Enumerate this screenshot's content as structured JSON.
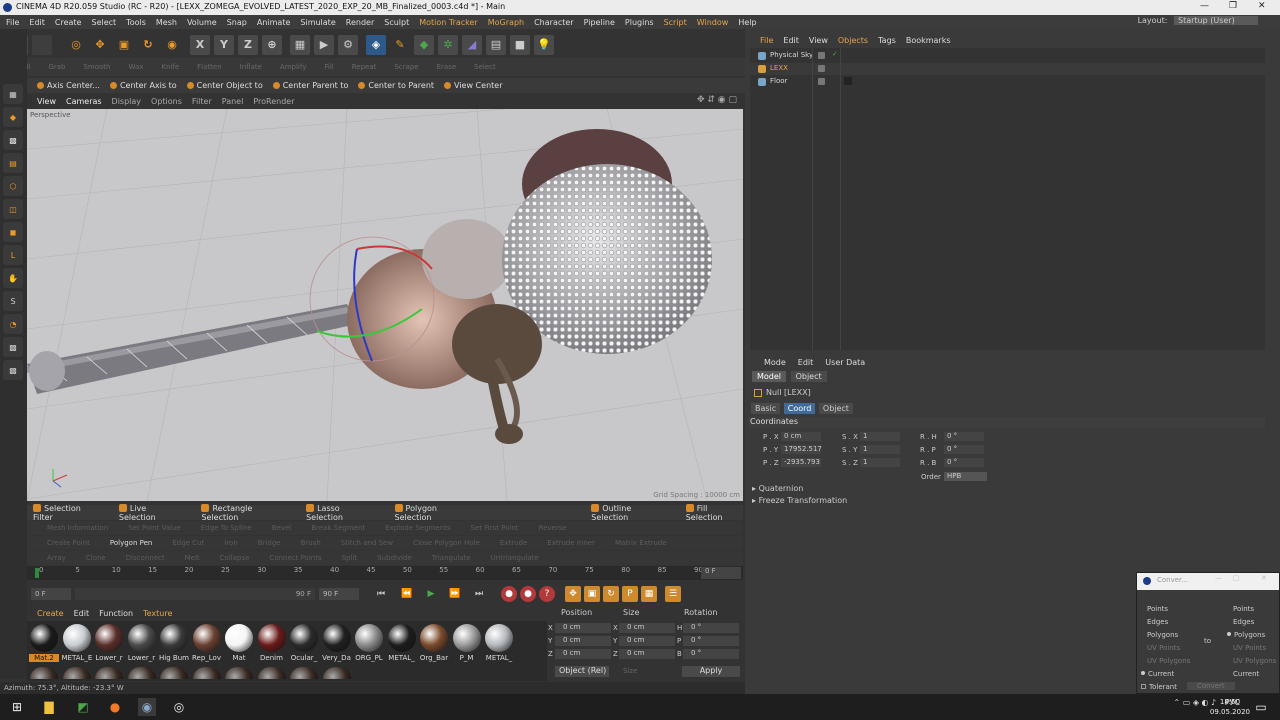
{
  "title_bar": {
    "title": "CINEMA 4D R20.059 Studio (RC - R20) - [LEXX_ZOMEGA_EVOLVED_LATEST_2020_EXP_20_MB_Finalized_0003.c4d *] - Main",
    "minimize": "—",
    "maximize": "❐",
    "close": "✕"
  },
  "menu": {
    "items": [
      "File",
      "Edit",
      "Create",
      "Select",
      "Tools",
      "Mesh",
      "Volume",
      "Snap",
      "Animate",
      "Simulate",
      "Render",
      "Sculpt",
      "Motion Tracker",
      "MoGraph",
      "Character",
      "Pipeline",
      "Plugins",
      "Script",
      "Window",
      "Help"
    ],
    "layout_label": "Layout:",
    "layout_value": "Startup (User)"
  },
  "top_toolbar": {
    "undo": "↶",
    "axis_x": "X",
    "axis_y": "Y",
    "axis_z": "Z"
  },
  "dim_tools": [
    "Pull",
    "Grab",
    "Smooth",
    "Wax",
    "Knife",
    "Flatten",
    "Inflate",
    "Amplify",
    "Fill",
    "Repeat",
    "Scrape",
    "Erase",
    "Select"
  ],
  "axis_bar": [
    "Axis Center...",
    "Center Axis to",
    "Center Object to",
    "Center Parent to",
    "Center to Parent",
    "View Center"
  ],
  "viewport": {
    "menu": [
      "View",
      "Cameras",
      "Display",
      "Options",
      "Filter",
      "Panel",
      "ProRender"
    ],
    "label": "Perspective",
    "grid_spacing": "Grid Spacing : 10000 cm"
  },
  "selection_bar": [
    "Selection Filter",
    "Live Selection",
    "Rectangle Selection",
    "Lasso Selection",
    "Polygon Selection",
    "Outline Selection",
    "Fill Selection"
  ],
  "dim_rows": [
    [
      "Mesh Information",
      "Set Point Value",
      "Edge To Spline",
      "Bevel",
      "Break Segment",
      "Explode Segments",
      "Set First Point",
      "Reverse"
    ],
    [
      "Create Point",
      "Polygon Pen",
      "Edge Cut",
      "Iron",
      "Bridge",
      "Brush",
      "Stitch and Sew",
      "Close Polygon Hole",
      "Extrude",
      "Extrude Inner",
      "Matrix Extrude"
    ],
    [
      "Array",
      "Clone",
      "Disconnect",
      "Melt",
      "Collapse",
      "Connect Points",
      "Split",
      "Subdivide",
      "Triangulate",
      "Untriangulate"
    ]
  ],
  "timeline": {
    "ticks": [
      "0",
      "5",
      "10",
      "15",
      "20",
      "25",
      "30",
      "35",
      "40",
      "45",
      "50",
      "55",
      "60",
      "65",
      "70",
      "75",
      "80",
      "85",
      "90"
    ],
    "end_frame": "0 F",
    "start_field": "0 F",
    "mid_field": "90 F",
    "end_field": "90 F"
  },
  "playback": {
    "first": "⏮",
    "prev": "⏪",
    "play": "▶",
    "next": "⏩",
    "last": "⏭"
  },
  "material_manager": {
    "menu": [
      "Create",
      "Edit",
      "Function",
      "Texture"
    ],
    "materials": [
      {
        "name": "Mat.2",
        "color": "#1a1a1a",
        "selected": true
      },
      {
        "name": "METAL_E",
        "color": "#c8ccd0"
      },
      {
        "name": "Lower_r",
        "color": "#5a2e2a"
      },
      {
        "name": "Lower_r",
        "color": "#4a4a4a"
      },
      {
        "name": "Hig Bum",
        "color": "#3a3a3a"
      },
      {
        "name": "Rep_Lov",
        "color": "#6a4030"
      },
      {
        "name": "Mat",
        "color": "#f4f4f4"
      },
      {
        "name": "Denim",
        "color": "#6a1a1a"
      },
      {
        "name": "Ocular_",
        "color": "#2a2a2a"
      },
      {
        "name": "Very_Da",
        "color": "#202020"
      },
      {
        "name": "ORG_PL",
        "color": "#8a8a8a"
      },
      {
        "name": "METAL_",
        "color": "#1c1c1c"
      },
      {
        "name": "Org_Bar",
        "color": "#7a4a2a"
      },
      {
        "name": "P_M",
        "color": "#9a9a9a"
      },
      {
        "name": "METAL_",
        "color": "#b4b8bc"
      }
    ]
  },
  "coord_manager": {
    "headers": [
      "Position",
      "Size",
      "Rotation"
    ],
    "rows": [
      {
        "axis": "X",
        "pos": "0 cm",
        "size_axis": "X",
        "size": "0 cm",
        "rot_axis": "H",
        "rot": "0 °"
      },
      {
        "axis": "Y",
        "pos": "0 cm",
        "size_axis": "Y",
        "size": "0 cm",
        "rot_axis": "P",
        "rot": "0 °"
      },
      {
        "axis": "Z",
        "pos": "0 cm",
        "size_axis": "Z",
        "size": "0 cm",
        "rot_axis": "B",
        "rot": "0 °"
      }
    ],
    "mode": "Object (Rel)",
    "size_mode": "Size",
    "apply": "Apply"
  },
  "status": "Azimuth: 75.3°, Altitude: -23.3°  W",
  "object_manager": {
    "menu": [
      "File",
      "Edit",
      "View",
      "Objects",
      "Tags",
      "Bookmarks"
    ],
    "objects": [
      {
        "name": "Physical Sky",
        "color": "#7aa4c8"
      },
      {
        "name": "LEXX",
        "color": "#d8a040",
        "highlight": true
      },
      {
        "name": "Floor",
        "color": "#7aa4c8"
      }
    ]
  },
  "attribute_manager": {
    "menu": [
      "Mode",
      "Edit",
      "User Data"
    ],
    "tabs": [
      "Model",
      "Object"
    ],
    "title": "Null [LEXX]",
    "subtabs": [
      "Basic",
      "Coord",
      "Object"
    ],
    "section": "Coordinates",
    "fields": [
      {
        "label": "P . X",
        "value": "0 cm",
        "slabel": "S . X",
        "svalue": "1",
        "rlabel": "R . H",
        "rvalue": "0 °"
      },
      {
        "label": "P . Y",
        "value": "17952.517",
        "slabel": "S . Y",
        "svalue": "1",
        "rlabel": "R . P",
        "rvalue": "0 °"
      },
      {
        "label": "P . Z",
        "value": "-2935.793",
        "slabel": "S . Z",
        "svalue": "1",
        "rlabel": "R . B",
        "rvalue": "0 °"
      }
    ],
    "order_label": "Order",
    "order_value": "HPB",
    "sections": [
      "Quaternion",
      "Freeze Transformation"
    ]
  },
  "converter": {
    "title": "Conver...",
    "left": [
      "Points",
      "Edges",
      "Polygons",
      "UV Points",
      "UV Polygons",
      "Current",
      "Tolerant"
    ],
    "right": [
      "Points",
      "Edges",
      "Polygons",
      "UV Points",
      "UV Polygons",
      "Current"
    ],
    "to": "to",
    "convert": "Convert"
  },
  "taskbar": {
    "lang": "РУС",
    "time": "18:50",
    "date": "09.05.2020"
  }
}
